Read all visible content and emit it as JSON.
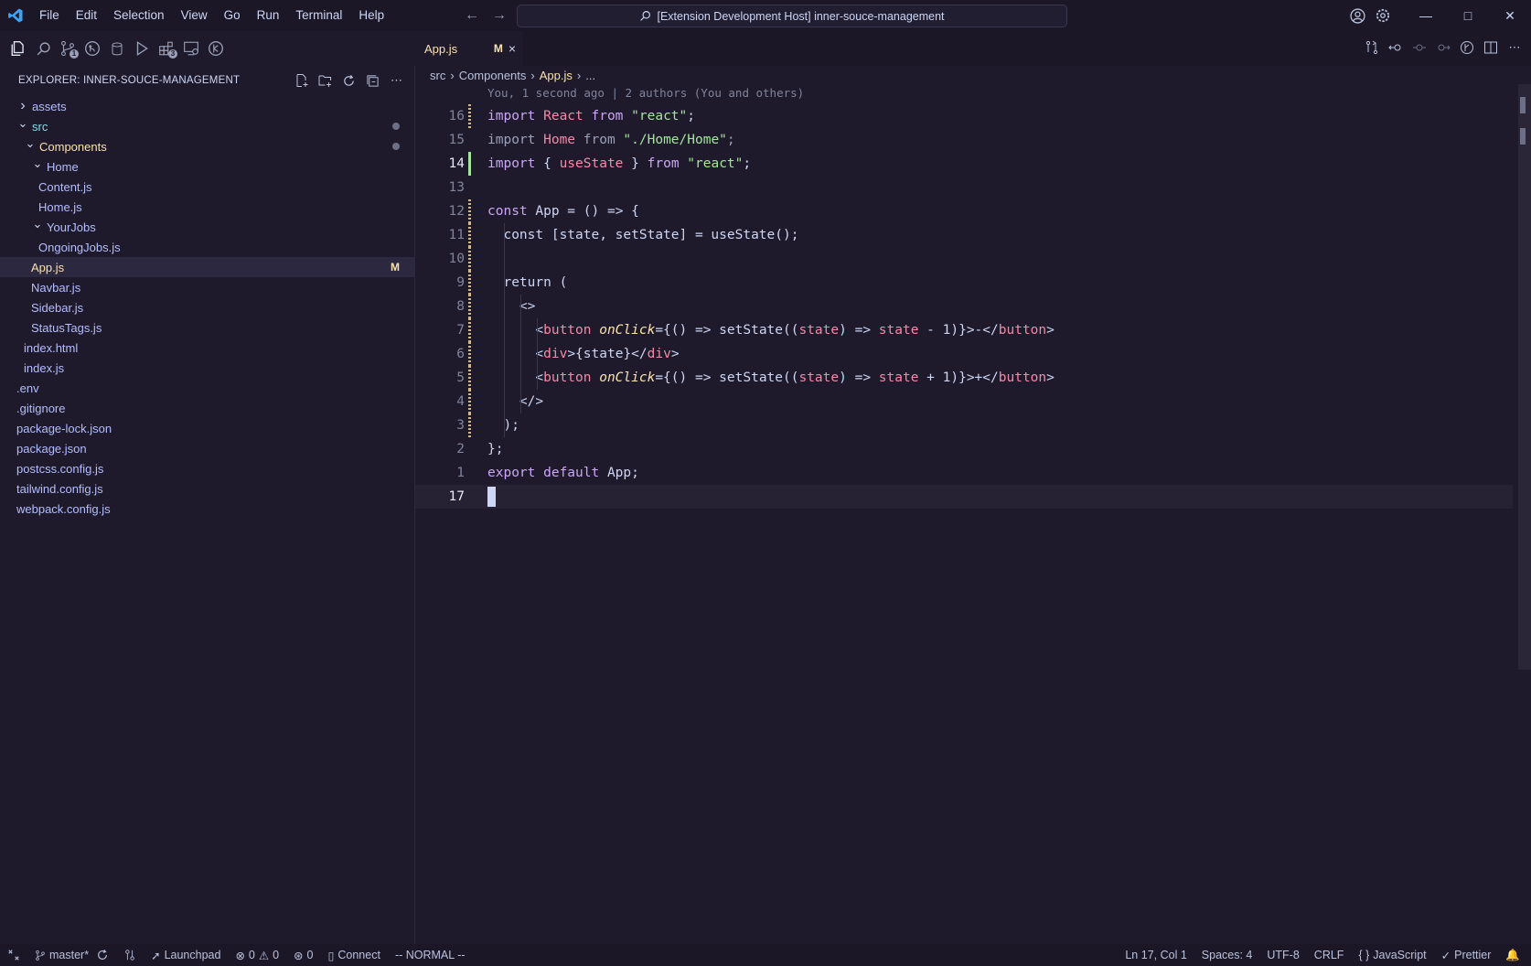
{
  "titlebar": {
    "menu": [
      "File",
      "Edit",
      "Selection",
      "View",
      "Go",
      "Run",
      "Terminal",
      "Help"
    ],
    "search_text": "[Extension Development Host] inner-souce-management"
  },
  "activity": {
    "badges": {
      "scm": "1",
      "extensions": "3"
    }
  },
  "sidebar": {
    "title": "EXPLORER: INNER-SOUCE-MANAGEMENT",
    "tree": [
      {
        "label": "assets",
        "depth": 0,
        "type": "folder-closed"
      },
      {
        "label": "src",
        "depth": 0,
        "type": "folder-open",
        "dot": true
      },
      {
        "label": "Components",
        "depth": 1,
        "type": "folder-open",
        "dot": true
      },
      {
        "label": "Home",
        "depth": 2,
        "type": "folder-open"
      },
      {
        "label": "Content.js",
        "depth": 3,
        "type": "file"
      },
      {
        "label": "Home.js",
        "depth": 3,
        "type": "file"
      },
      {
        "label": "YourJobs",
        "depth": 2,
        "type": "folder-open"
      },
      {
        "label": "OngoingJobs.js",
        "depth": 3,
        "type": "file"
      },
      {
        "label": "App.js",
        "depth": 2,
        "type": "file",
        "selected": true,
        "mark": "M"
      },
      {
        "label": "Navbar.js",
        "depth": 2,
        "type": "file"
      },
      {
        "label": "Sidebar.js",
        "depth": 2,
        "type": "file"
      },
      {
        "label": "StatusTags.js",
        "depth": 2,
        "type": "file"
      },
      {
        "label": "index.html",
        "depth": 1,
        "type": "file"
      },
      {
        "label": "index.js",
        "depth": 1,
        "type": "file"
      },
      {
        "label": ".env",
        "depth": 0,
        "type": "file"
      },
      {
        "label": ".gitignore",
        "depth": 0,
        "type": "file"
      },
      {
        "label": "package-lock.json",
        "depth": 0,
        "type": "file"
      },
      {
        "label": "package.json",
        "depth": 0,
        "type": "file"
      },
      {
        "label": "postcss.config.js",
        "depth": 0,
        "type": "file"
      },
      {
        "label": "tailwind.config.js",
        "depth": 0,
        "type": "file"
      },
      {
        "label": "webpack.config.js",
        "depth": 0,
        "type": "file"
      }
    ]
  },
  "editor": {
    "tab": {
      "label": "App.js",
      "mark": "M",
      "close": "×"
    },
    "breadcrumb": [
      "src",
      "Components",
      "App.js",
      "..."
    ],
    "blame": "You, 1 second ago | 2 authors (You and others)",
    "lines": [
      {
        "n": "16",
        "g": "mod",
        "tokens": [
          [
            "kw",
            "import "
          ],
          [
            "v",
            "React"
          ],
          [
            "kw",
            " from "
          ],
          [
            "s",
            "\"react\""
          ],
          [
            "k",
            ";"
          ]
        ]
      },
      {
        "n": "15",
        "g": "",
        "tokens": [
          [
            "dim",
            "import "
          ],
          [
            "v",
            "Home"
          ],
          [
            "dim",
            " from "
          ],
          [
            "s",
            "\"./Home/Home\""
          ],
          [
            "dim",
            ";"
          ]
        ]
      },
      {
        "n": "14",
        "g": "add",
        "tokens": [
          [
            "kw",
            "import "
          ],
          [
            "k",
            "{ "
          ],
          [
            "v",
            "useState"
          ],
          [
            "k",
            " } "
          ],
          [
            "kw",
            "from "
          ],
          [
            "s",
            "\"react\""
          ],
          [
            "k",
            ";"
          ]
        ]
      },
      {
        "n": "13",
        "g": "",
        "tokens": []
      },
      {
        "n": "12",
        "g": "mod",
        "tokens": [
          [
            "kw",
            "const "
          ],
          [
            "k",
            "App = () => {"
          ]
        ]
      },
      {
        "n": "11",
        "g": "mod",
        "tokens": [
          [
            "k",
            "  const [state, setState] = useState();"
          ]
        ]
      },
      {
        "n": "10",
        "g": "mod",
        "tokens": []
      },
      {
        "n": "9",
        "g": "mod",
        "tokens": [
          [
            "k",
            "  return ("
          ]
        ]
      },
      {
        "n": "8",
        "g": "mod",
        "tokens": [
          [
            "k",
            "    <>"
          ]
        ]
      },
      {
        "n": "7",
        "g": "mod",
        "tokens": [
          [
            "k",
            "      <"
          ],
          [
            "t",
            "button "
          ],
          [
            "a",
            "onClick"
          ],
          [
            "k",
            "={() => setState(("
          ],
          [
            "v",
            "state"
          ],
          [
            "k",
            ") => "
          ],
          [
            "v",
            "state"
          ],
          [
            "k",
            " - 1)}>-</"
          ],
          [
            "t",
            "button"
          ],
          [
            "k",
            ">"
          ]
        ]
      },
      {
        "n": "6",
        "g": "mod",
        "tokens": [
          [
            "k",
            "      <"
          ],
          [
            "t",
            "div"
          ],
          [
            "k",
            ">{state}</"
          ],
          [
            "t",
            "div"
          ],
          [
            "k",
            ">"
          ]
        ]
      },
      {
        "n": "5",
        "g": "mod",
        "tokens": [
          [
            "k",
            "      <"
          ],
          [
            "t",
            "button "
          ],
          [
            "a",
            "onClick"
          ],
          [
            "k",
            "={() => setState(("
          ],
          [
            "v",
            "state"
          ],
          [
            "k",
            ") => "
          ],
          [
            "v",
            "state"
          ],
          [
            "k",
            " + 1)}>+</"
          ],
          [
            "t",
            "button"
          ],
          [
            "k",
            ">"
          ]
        ]
      },
      {
        "n": "4",
        "g": "mod",
        "tokens": [
          [
            "k",
            "    </>"
          ]
        ]
      },
      {
        "n": "3",
        "g": "mod",
        "tokens": [
          [
            "k",
            "  );"
          ]
        ]
      },
      {
        "n": "2",
        "g": "",
        "tokens": [
          [
            "k",
            "};"
          ]
        ]
      },
      {
        "n": "1",
        "g": "",
        "tokens": [
          [
            "kw",
            "export default "
          ],
          [
            "k",
            "App;"
          ]
        ]
      },
      {
        "n": "17",
        "g": "",
        "current": true,
        "tokens": []
      }
    ]
  },
  "statusbar": {
    "branch": "master*",
    "launchpad": "Launchpad",
    "errors": "0",
    "warnings": "0",
    "ports": "0",
    "connect": "Connect",
    "mode": "-- NORMAL --",
    "position": "Ln 17, Col 1",
    "spaces": "Spaces: 4",
    "encoding": "UTF-8",
    "eol": "CRLF",
    "language": "JavaScript",
    "formatter": "Prettier"
  },
  "colors": {
    "background": "#1e1a2b",
    "accent_yellow": "#f9e2af",
    "gutter_added": "#a6e3a1",
    "gutter_modified": "#f9e2af"
  }
}
